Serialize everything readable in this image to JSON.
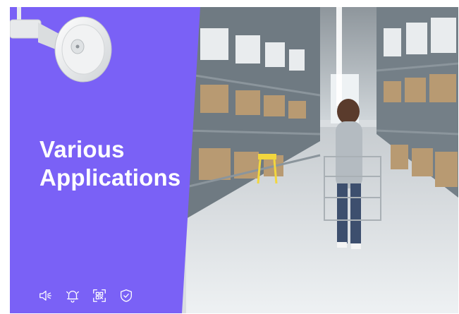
{
  "hero": {
    "title_line1": "Various",
    "title_line2": "Applications"
  },
  "colors": {
    "panel": "#7a61f6",
    "icon_stroke": "#ffffff"
  },
  "icons": [
    "speaker-icon",
    "bell-icon",
    "scan-icon",
    "shield-check-icon"
  ]
}
